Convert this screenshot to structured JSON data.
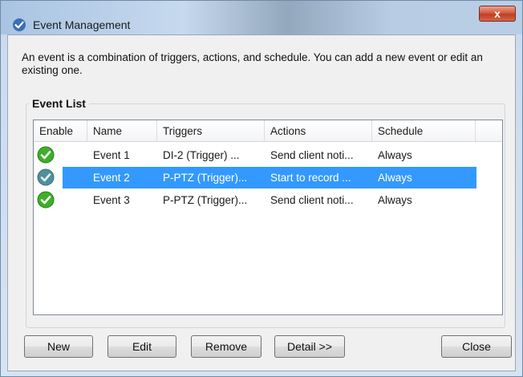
{
  "window": {
    "title": "Event Management",
    "close_label": "x"
  },
  "description": "An event is a combination of triggers, actions, and schedule. You can add a new event or edit an existing one.",
  "event_list": {
    "group_title": "Event List",
    "columns": [
      "Enable",
      "Name",
      "Triggers",
      "Actions",
      "Schedule"
    ],
    "rows": [
      {
        "enabled": true,
        "name": "Event 1",
        "triggers": "DI-2 (Trigger) ...",
        "actions": "Send client noti...",
        "schedule": "Always",
        "selected": false
      },
      {
        "enabled": true,
        "name": "Event 2",
        "triggers": "P-PTZ (Trigger)...",
        "actions": "Start to record ...",
        "schedule": "Always",
        "selected": true
      },
      {
        "enabled": true,
        "name": "Event 3",
        "triggers": "P-PTZ (Trigger)...",
        "actions": "Send client noti...",
        "schedule": "Always",
        "selected": false
      }
    ]
  },
  "buttons": {
    "new": "New",
    "edit": "Edit",
    "remove": "Remove",
    "detail": "Detail >>",
    "close": "Close"
  },
  "colors": {
    "selection": "#3399ff",
    "check_green": "#3fae2a",
    "check_selected": "#4f8f9a",
    "close_red": "#c23d22"
  },
  "icons": {
    "title": "shield-check-icon",
    "enabled": "green-check-circle-icon"
  }
}
